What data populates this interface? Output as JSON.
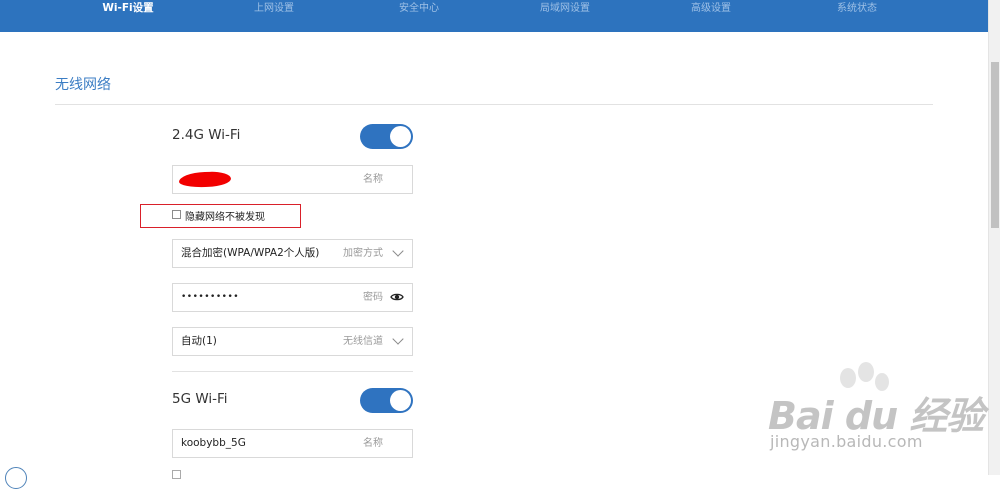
{
  "nav": {
    "tabs": [
      {
        "label": "Wi-Fi设置",
        "active": true
      },
      {
        "label": "上网设置",
        "active": false
      },
      {
        "label": "安全中心",
        "active": false
      },
      {
        "label": "局域网设置",
        "active": false
      },
      {
        "label": "高级设置",
        "active": false
      },
      {
        "label": "系统状态",
        "active": false
      }
    ]
  },
  "section": {
    "title": "无线网络"
  },
  "wifi24": {
    "label": "2.4G Wi-Fi",
    "enabled": true,
    "name_hint": "名称",
    "hide_network_label": "隐藏网络不被发现",
    "hide_network_checked": false,
    "encryption_value": "混合加密(WPA/WPA2个人版)",
    "encryption_hint": "加密方式",
    "password_value": "••••••••••",
    "password_hint": "密码",
    "channel_value": "自动(1)",
    "channel_hint": "无线信道"
  },
  "wifi5": {
    "label": "5G Wi-Fi",
    "enabled": true,
    "name_value": "koobybb_5G",
    "name_hint": "名称"
  },
  "watermark": {
    "logo": "Bai du 经验",
    "url": "jingyan.baidu.com"
  },
  "colors": {
    "nav_bg": "#2d73be",
    "accent": "#3b7dc4",
    "toggle_on": "#2f73c0",
    "highlight_box": "#d9202a"
  }
}
